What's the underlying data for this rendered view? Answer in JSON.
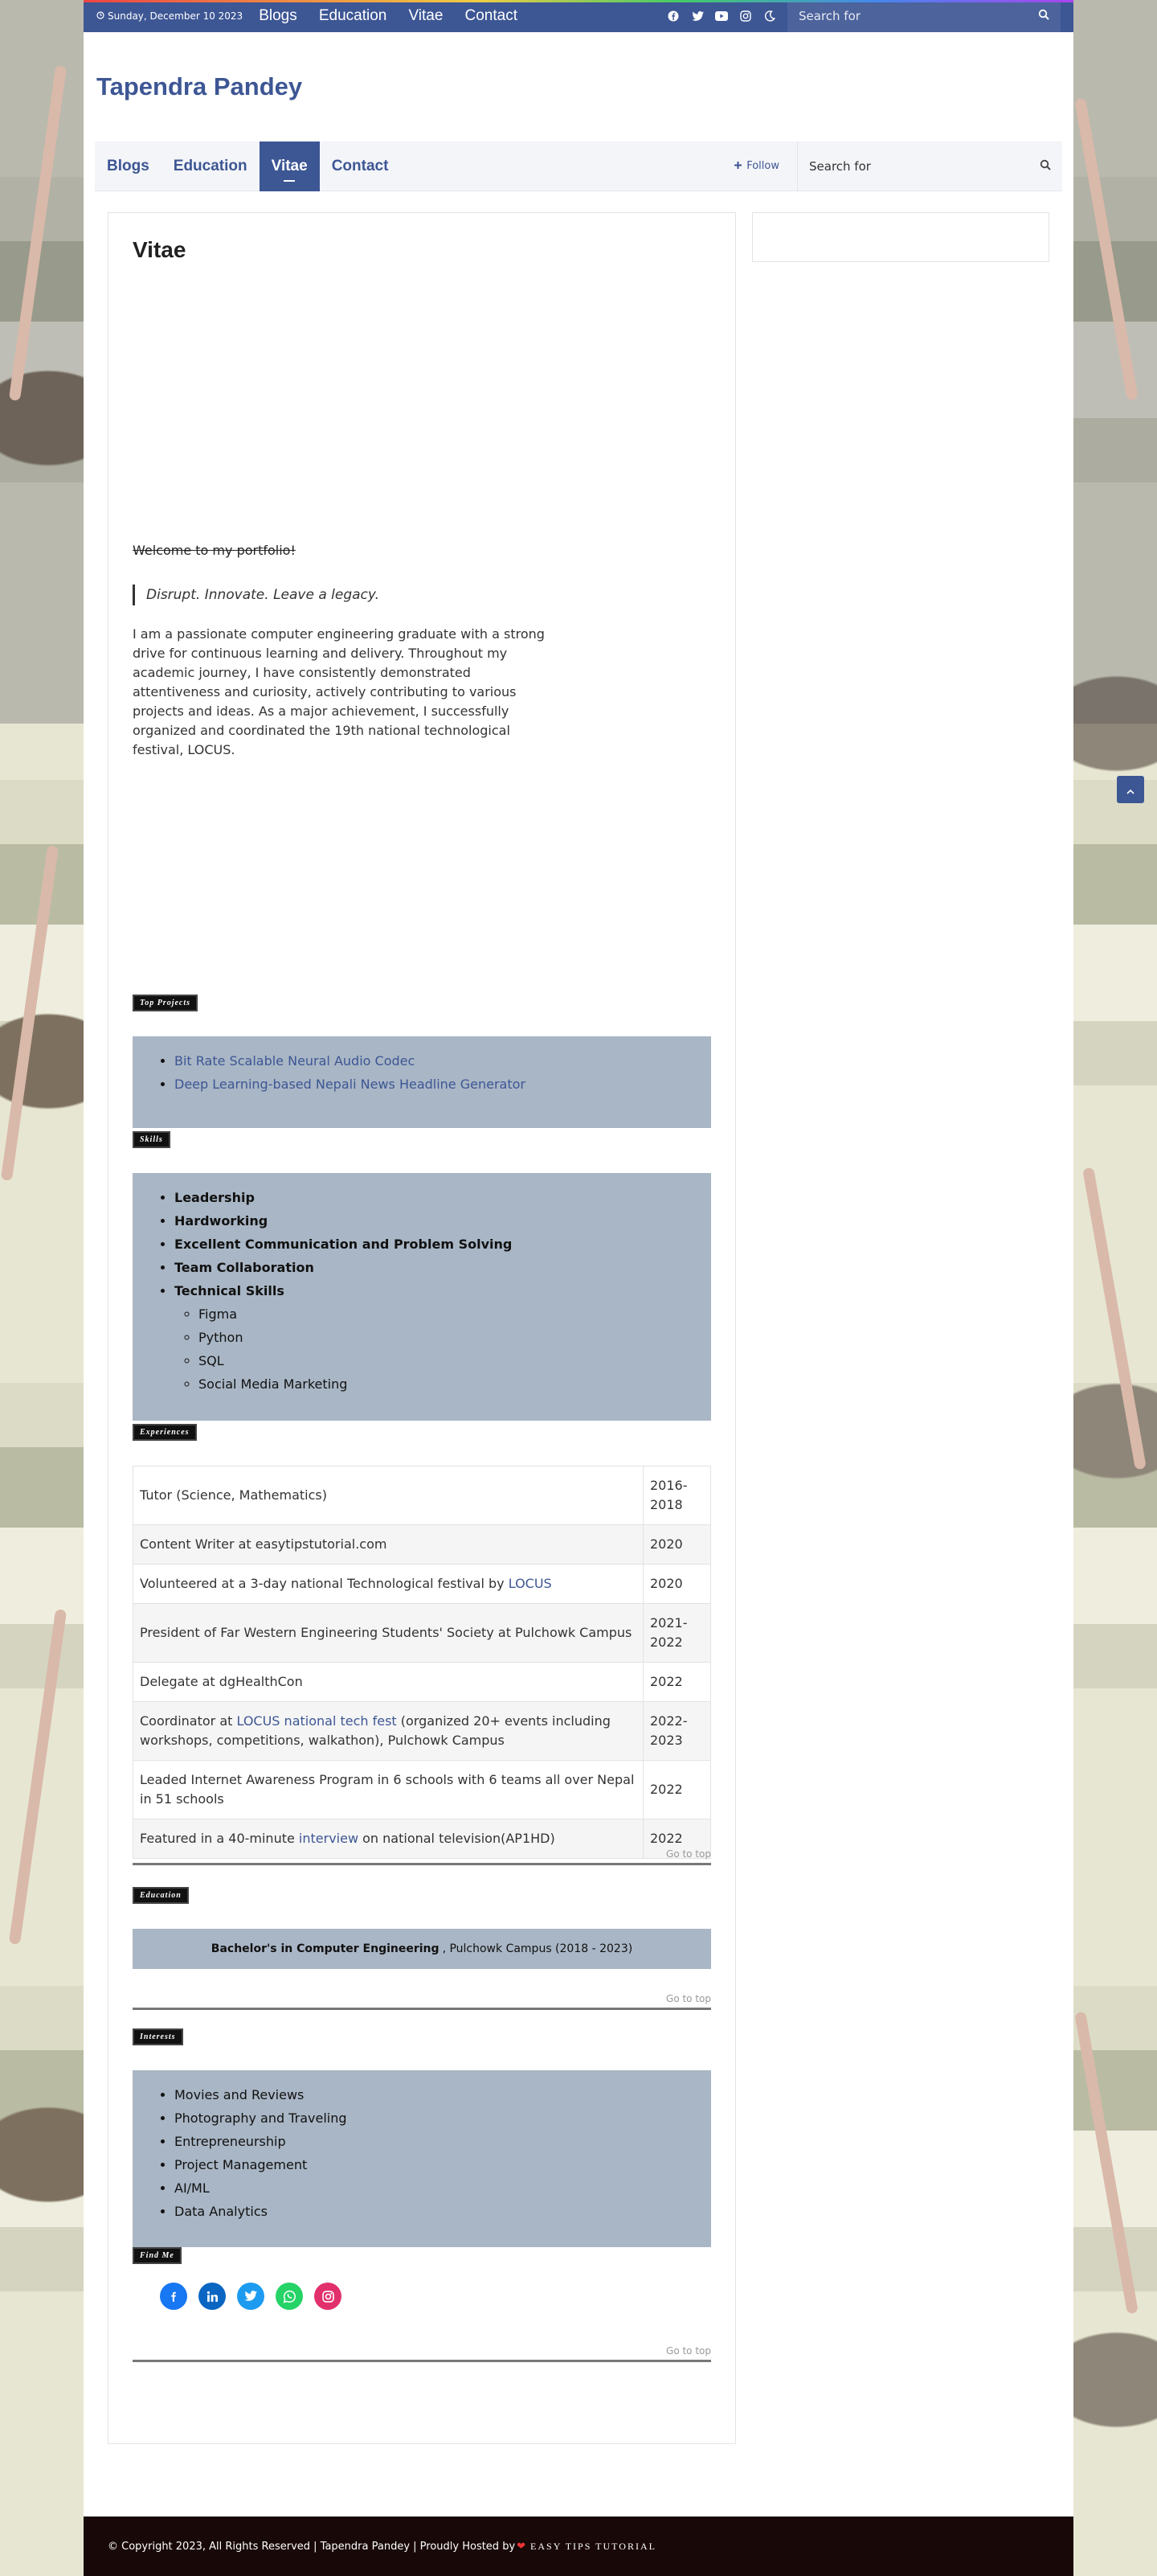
{
  "topbar": {
    "date": "Sunday, December 10 2023",
    "nav": [
      "Blogs",
      "Education",
      "Vitae",
      "Contact"
    ],
    "social_icons": [
      "facebook-icon",
      "twitter-icon",
      "youtube-icon",
      "instagram-icon",
      "moon-icon"
    ],
    "search_placeholder": "Search for"
  },
  "site": {
    "title": "Tapendra Pandey"
  },
  "mainnav": {
    "items": [
      "Blogs",
      "Education",
      "Vitae",
      "Contact"
    ],
    "active": "Vitae",
    "follow_label": "Follow",
    "search_placeholder": "Search for"
  },
  "article": {
    "title": "Vitae",
    "welcome": "Welcome to my portfolio!",
    "quote": "Disrupt. Innovate. Leave a legacy.",
    "intro": "I am a passionate computer engineering graduate with a strong drive for continuous learning and delivery. Throughout my academic journey, I have consistently demonstrated attentiveness and curiosity, actively contributing to various projects and ideas. As a major achievement, I successfully organized and coordinated the 19th national technological festival, LOCUS.",
    "sections": {
      "projects": "Top Projects",
      "skills": "Skills",
      "experiences": "Experiences",
      "education": "Education",
      "interests": "Interests",
      "find_me": "Find Me"
    },
    "projects": [
      "Bit Rate Scalable Neural Audio Codec",
      "Deep Learning-based Nepali News Headline Generator"
    ],
    "skills": [
      "Leadership",
      "Hardworking",
      "Excellent Communication and Problem Solving",
      "Team Collaboration",
      "Technical Skills"
    ],
    "technical_skills": [
      "Figma",
      "Python",
      "SQL",
      "Social Media Marketing"
    ],
    "experiences": [
      {
        "pre": "Tutor (Science, Mathematics)",
        "link": "",
        "post": "",
        "year": "2016-2018"
      },
      {
        "pre": "Content Writer at easytipstutorial.com",
        "link": "",
        "post": "",
        "year": "2020"
      },
      {
        "pre": "Volunteered at a 3-day national Technological festival by ",
        "link": "LOCUS",
        "post": "",
        "year": "2020"
      },
      {
        "pre": "President of Far Western Engineering Students' Society at Pulchowk Campus",
        "link": "",
        "post": "",
        "year": "2021-2022"
      },
      {
        "pre": "Delegate at dgHealthCon",
        "link": "",
        "post": "",
        "year": "2022"
      },
      {
        "pre": "Coordinator at ",
        "link": "LOCUS national tech fest",
        "post": " (organized 20+ events including workshops, competitions, walkathon), Pulchowk Campus",
        "year": "2022-2023"
      },
      {
        "pre": "Leaded Internet Awareness Program in 6 schools with 6 teams all over Nepal in 51 schools",
        "link": "",
        "post": "",
        "year": "2022"
      },
      {
        "pre": "Featured in a 40-minute ",
        "link": "interview",
        "post": " on national television(AP1HD)",
        "year": "2022"
      }
    ],
    "education": {
      "degree": "Bachelor's in Computer Engineering",
      "detail": ", Pulchowk Campus (2018 - 2023)"
    },
    "interests": [
      "Movies and Reviews",
      "Photography and Traveling",
      "Entrepreneurship",
      "Project Management",
      "AI/ML",
      "Data Analytics"
    ],
    "go_to_top": "Go to top",
    "find_me_icons": [
      "facebook-icon",
      "linkedin-icon",
      "twitter-icon",
      "whatsapp-icon",
      "instagram-icon"
    ]
  },
  "footer": {
    "copyright": "© Copyright 2023, All Rights Reserved  |  Tapendra Pandey | Proudly Hosted by",
    "host": "EASY TIPS TUTORIAL"
  },
  "colors": {
    "brand": "#3d5694",
    "box": "#a9b6c5",
    "footer": "#180808"
  }
}
